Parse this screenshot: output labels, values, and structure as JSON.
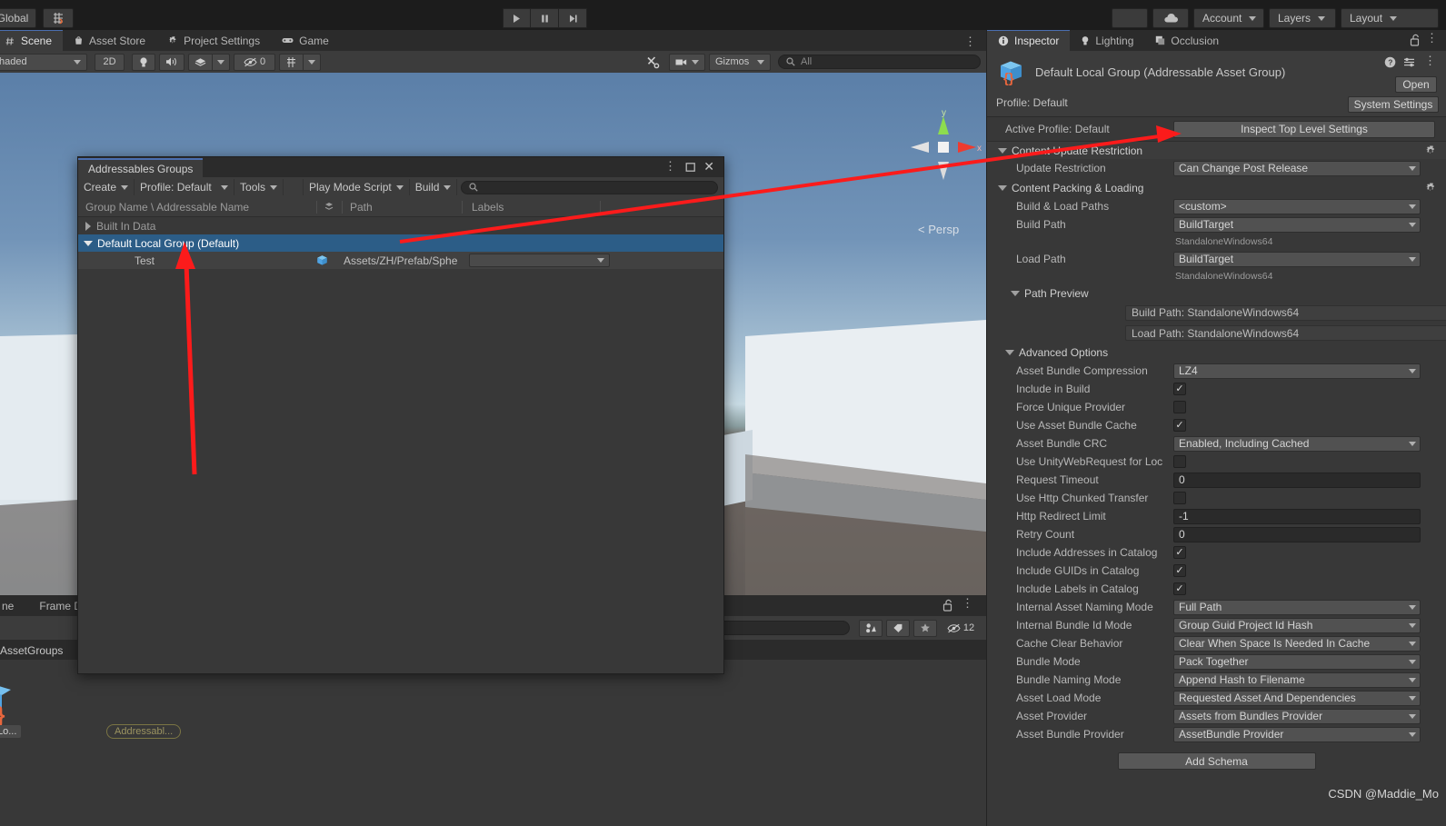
{
  "top_toolbar": {
    "global_label": "Global",
    "snap_icon": "grid-snap-icon",
    "play_icon": "play-icon",
    "pause_icon": "pause-icon",
    "step_icon": "step-icon",
    "cloud_icon": "cloud-icon",
    "account": "Account",
    "layers": "Layers",
    "layout": "Layout"
  },
  "scene_panel": {
    "tabs": [
      {
        "label": "Scene",
        "icon": "scene-hash-icon",
        "active": true
      },
      {
        "label": "Asset Store",
        "icon": "store-bag-icon",
        "active": false
      },
      {
        "label": "Project Settings",
        "icon": "gear-icon",
        "active": false
      },
      {
        "label": "Game",
        "icon": "gamepad-icon",
        "active": false
      }
    ],
    "toolbar": {
      "shading_mode": "haded",
      "mode_2d": "2D",
      "lighting_icon": "lightbulb-icon",
      "audio_icon": "speaker-icon",
      "fx_icon": "effects-icon",
      "hidden_count": "0",
      "grid_icon": "grid-icon",
      "tools_icon": "tools-icon",
      "camera_icon": "camera-icon",
      "gizmos_label": "Gizmos",
      "search_placeholder": "All",
      "search_value": ""
    },
    "gizmo": {
      "y_label": "y",
      "x_label": "x",
      "perspective_label": "Persp"
    }
  },
  "scene_bottom": {
    "tab_left": "ne",
    "tab_right": "Frame De",
    "tab2": "AssetGroups",
    "chip_label": "Addressabl...",
    "search_value": "",
    "hidden_count": "12",
    "lock_icon": "lock-open-icon",
    "menu_icon": "kebab-menu-icon"
  },
  "addressables_window": {
    "title": "Addressables Groups",
    "menu_icon": "kebab-menu-icon",
    "maximize_icon": "maximize-icon",
    "close_icon": "close-icon",
    "toolbar": {
      "create": "Create",
      "profile": "Profile: Default",
      "tools": "Tools",
      "play_mode_script": "Play Mode Script",
      "build": "Build",
      "search_value": "",
      "search_icon": "search-icon"
    },
    "columns": {
      "group_name": "Group Name \\ Addressable Name",
      "icon_col": "asset-type-icon",
      "path": "Path",
      "labels": "Labels"
    },
    "rows": [
      {
        "name": "Built In Data",
        "expanded": false,
        "selected": false,
        "type": "group",
        "path": "",
        "labels": ""
      },
      {
        "name": "Default Local Group (Default)",
        "expanded": true,
        "selected": true,
        "type": "group",
        "path": "",
        "labels": ""
      },
      {
        "name": "Test",
        "expanded": null,
        "selected": false,
        "type": "entry",
        "path": "Assets/ZH/Prefab/Sphe",
        "labels": ""
      }
    ]
  },
  "inspector": {
    "tabs": [
      {
        "label": "Inspector",
        "icon": "info-icon",
        "active": true
      },
      {
        "label": "Lighting",
        "icon": "lightbulb-icon",
        "active": false
      },
      {
        "label": "Occlusion",
        "icon": "occlusion-icon",
        "active": false
      }
    ],
    "lock_icon": "lock-open-icon",
    "menu_icon": "kebab-menu-icon",
    "header": {
      "object_icon": "addressable-group-icon",
      "title": "Default Local Group (Addressable Asset Group)",
      "help_icon": "help-icon",
      "preset_icon": "preset-icon",
      "kebab_icon": "kebab-menu-icon",
      "open_button": "Open",
      "profile_label": "Profile: Default",
      "system_settings_button": "System Settings"
    },
    "active_profile": {
      "label": "Active Profile: Default",
      "inspect_button": "Inspect Top Level Settings"
    },
    "sections": [
      {
        "id": "content_update_restriction",
        "title": "Content Update Restriction",
        "expanded": true,
        "gear_icon": "gear-icon",
        "fields": [
          {
            "label": "Update Restriction",
            "type": "dropdown",
            "value": "Can Change Post Release"
          }
        ]
      },
      {
        "id": "content_packing_loading",
        "title": "Content Packing & Loading",
        "expanded": true,
        "gear_icon": "gear-icon",
        "fields": [
          {
            "label": "Build & Load Paths",
            "type": "dropdown",
            "value": "<custom>"
          },
          {
            "label": "Build Path",
            "type": "dropdown",
            "value": "BuildTarget",
            "note": "StandaloneWindows64"
          },
          {
            "label": "Load Path",
            "type": "dropdown",
            "value": "BuildTarget",
            "note": "StandaloneWindows64"
          }
        ]
      }
    ],
    "path_preview": {
      "title": "Path Preview",
      "expanded": true,
      "items": [
        "Build Path: StandaloneWindows64",
        "Load Path: StandaloneWindows64"
      ]
    },
    "advanced_options": {
      "title": "Advanced Options",
      "expanded": true,
      "fields": [
        {
          "label": "Asset Bundle Compression",
          "type": "dropdown",
          "value": "LZ4"
        },
        {
          "label": "Include in Build",
          "type": "checkbox",
          "value": true
        },
        {
          "label": "Force Unique Provider",
          "type": "checkbox",
          "value": false
        },
        {
          "label": "Use Asset Bundle Cache",
          "type": "checkbox",
          "value": true
        },
        {
          "label": "Asset Bundle CRC",
          "type": "dropdown",
          "value": "Enabled, Including Cached"
        },
        {
          "label": "Use UnityWebRequest for Loc",
          "type": "checkbox",
          "value": false
        },
        {
          "label": "Request Timeout",
          "type": "text",
          "value": "0"
        },
        {
          "label": "Use Http Chunked Transfer",
          "type": "checkbox",
          "value": false
        },
        {
          "label": "Http Redirect Limit",
          "type": "text",
          "value": "-1"
        },
        {
          "label": "Retry Count",
          "type": "text",
          "value": "0"
        },
        {
          "label": "Include Addresses in Catalog",
          "type": "checkbox",
          "value": true
        },
        {
          "label": "Include GUIDs in Catalog",
          "type": "checkbox",
          "value": true
        },
        {
          "label": "Include Labels in Catalog",
          "type": "checkbox",
          "value": true
        },
        {
          "label": "Internal Asset Naming Mode",
          "type": "dropdown",
          "value": "Full Path"
        },
        {
          "label": "Internal Bundle Id Mode",
          "type": "dropdown",
          "value": "Group Guid Project Id Hash"
        },
        {
          "label": "Cache Clear Behavior",
          "type": "dropdown",
          "value": "Clear When Space Is Needed In Cache"
        },
        {
          "label": "Bundle Mode",
          "type": "dropdown",
          "value": "Pack Together"
        },
        {
          "label": "Bundle Naming Mode",
          "type": "dropdown",
          "value": "Append Hash to Filename"
        },
        {
          "label": "Asset Load Mode",
          "type": "dropdown",
          "value": "Requested Asset And Dependencies"
        },
        {
          "label": "Asset Provider",
          "type": "dropdown",
          "value": "Assets from Bundles Provider"
        },
        {
          "label": "Asset Bundle Provider",
          "type": "dropdown",
          "value": "AssetBundle Provider"
        }
      ]
    },
    "add_schema_button": "Add Schema"
  },
  "watermark": "CSDN @Maddie_Mo",
  "colors": {
    "accent_blue": "#4b6eaf",
    "selection_blue": "#2c5d87",
    "arrow_red": "#fb1b1b",
    "panel_bg": "#383838",
    "toolbar_bg": "#3c3c3c",
    "dark_bg": "#1c1c1c"
  }
}
